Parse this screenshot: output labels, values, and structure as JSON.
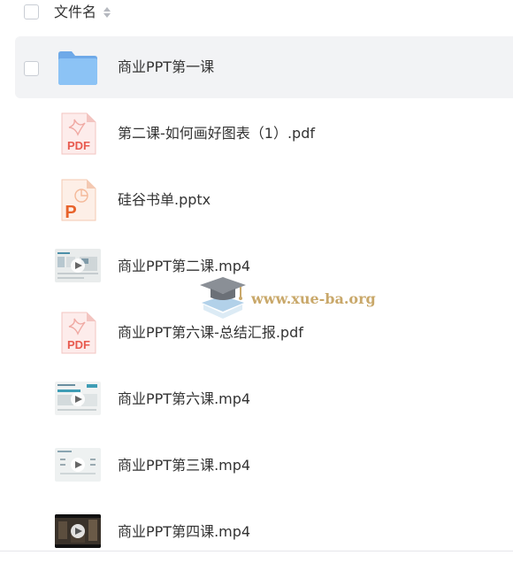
{
  "header": {
    "column_label": "文件名"
  },
  "files": [
    {
      "name": "商业PPT第一课",
      "icon": "folder-icon",
      "selected": true
    },
    {
      "name": "第二课-如何画好图表（1）.pdf",
      "icon": "pdf-file-icon",
      "badge": "PDF"
    },
    {
      "name": "硅谷书单.pptx",
      "icon": "pptx-file-icon",
      "badge": "P"
    },
    {
      "name": "商业PPT第二课.mp4",
      "icon": "video-thumbnail-icon"
    },
    {
      "name": "商业PPT第六课-总结汇报.pdf",
      "icon": "pdf-file-icon",
      "badge": "PDF"
    },
    {
      "name": "商业PPT第六课.mp4",
      "icon": "video-thumbnail-icon"
    },
    {
      "name": "商业PPT第三课.mp4",
      "icon": "video-thumbnail-icon"
    },
    {
      "name": "商业PPT第四课.mp4",
      "icon": "video-thumbnail-icon"
    }
  ],
  "watermark": {
    "text": "www.xue-ba.org",
    "icon": "graduation-cap-icon"
  },
  "colors": {
    "pdf_red": "#e85a4f",
    "ppt_orange": "#e8632b",
    "folder_blue": "#7ab7f0",
    "selected_row_bg": "#f2f3f5"
  }
}
